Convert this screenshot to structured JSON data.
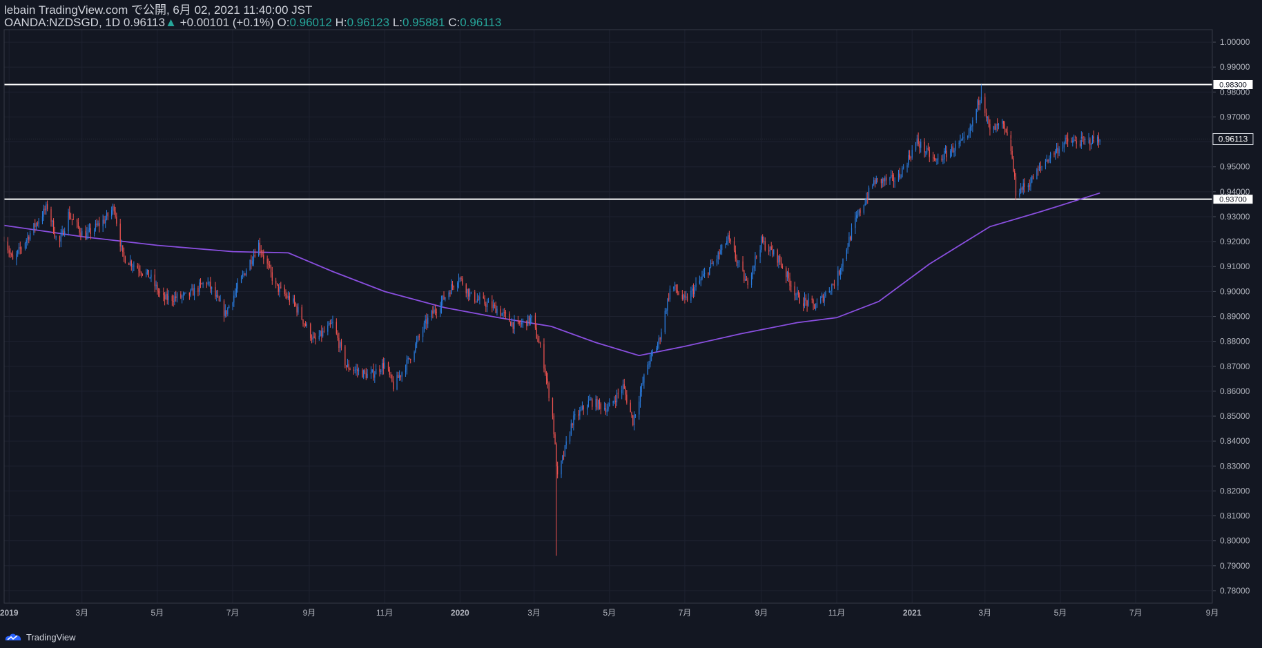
{
  "header": {
    "publish_line": "lebain TradingView.com で公開, 6月 02, 2021 11:40:00 JST",
    "symbol": "OANDA:NZDSGD, 1D",
    "last": "0.96113",
    "change_arrow": "▲",
    "change": "+0.00101 (+0.1%)",
    "o_label": "O:",
    "o_val": "0.96012",
    "h_label": "H:",
    "h_val": "0.96123",
    "l_label": "L:",
    "l_val": "0.95881",
    "c_label": "C:",
    "c_val": "0.96113"
  },
  "footer": {
    "brand": "TradingView",
    "logo_icon": "tradingview-logo-icon"
  },
  "colors": {
    "background": "#131722",
    "up": "#2a7de1",
    "down": "#ef5350",
    "ma": "#8a4fe0",
    "hline": "#ffffff",
    "grid": "#1e2230",
    "axis_text": "#b2b5be",
    "header_value": "#26a69a"
  },
  "chart_data": {
    "type": "candlestick",
    "symbol": "OANDA:NZDSGD",
    "interval": "1D",
    "ylim": [
      0.775,
      1.005
    ],
    "y_ticks": [
      1.0,
      0.99,
      0.98,
      0.97,
      0.96,
      0.95,
      0.94,
      0.93,
      0.92,
      0.91,
      0.9,
      0.89,
      0.88,
      0.87,
      0.86,
      0.85,
      0.84,
      0.83,
      0.82,
      0.81,
      0.8,
      0.79,
      0.78
    ],
    "y_tick_labels": [
      "1.00000",
      "0.99000",
      "0.98000",
      "0.97000",
      "0.96000",
      "0.95000",
      "0.94000",
      "0.93000",
      "0.92000",
      "0.91000",
      "0.90000",
      "0.89000",
      "0.88000",
      "0.87000",
      "0.86000",
      "0.85000",
      "0.84000",
      "0.83000",
      "0.82000",
      "0.81000",
      "0.80000",
      "0.79000",
      "0.78000"
    ],
    "x_ticks": [
      {
        "date": "2019-01-01",
        "label": "2019"
      },
      {
        "date": "2019-03-01",
        "label": "3月"
      },
      {
        "date": "2019-05-01",
        "label": "5月"
      },
      {
        "date": "2019-07-01",
        "label": "7月"
      },
      {
        "date": "2019-09-01",
        "label": "9月"
      },
      {
        "date": "2019-11-01",
        "label": "11月"
      },
      {
        "date": "2020-01-01",
        "label": "2020"
      },
      {
        "date": "2020-03-01",
        "label": "3月"
      },
      {
        "date": "2020-05-01",
        "label": "5月"
      },
      {
        "date": "2020-07-01",
        "label": "7月"
      },
      {
        "date": "2020-09-01",
        "label": "9月"
      },
      {
        "date": "2020-11-01",
        "label": "11月"
      },
      {
        "date": "2021-01-01",
        "label": "2021"
      },
      {
        "date": "2021-03-01",
        "label": "3月"
      },
      {
        "date": "2021-05-01",
        "label": "5月"
      },
      {
        "date": "2021-07-01",
        "label": "7月"
      },
      {
        "date": "2021-09-01",
        "label": "9月"
      }
    ],
    "x_start": "2018-12-28",
    "x_end": "2021-09-01",
    "horizontal_lines": [
      {
        "value": 0.983,
        "label": "0.98300"
      },
      {
        "value": 0.937,
        "label": "0.93700"
      }
    ],
    "last_price": {
      "value": 0.96113,
      "label": "0.96113"
    },
    "price_path": [
      {
        "date": "2018-12-28",
        "value": 0.922
      },
      {
        "date": "2019-01-04",
        "value": 0.912
      },
      {
        "date": "2019-01-20",
        "value": 0.925
      },
      {
        "date": "2019-02-01",
        "value": 0.934
      },
      {
        "date": "2019-02-10",
        "value": 0.918
      },
      {
        "date": "2019-02-18",
        "value": 0.931
      },
      {
        "date": "2019-03-03",
        "value": 0.922
      },
      {
        "date": "2019-03-20",
        "value": 0.929
      },
      {
        "date": "2019-03-27",
        "value": 0.934
      },
      {
        "date": "2019-04-03",
        "value": 0.914
      },
      {
        "date": "2019-04-25",
        "value": 0.906
      },
      {
        "date": "2019-05-05",
        "value": 0.897
      },
      {
        "date": "2019-05-25",
        "value": 0.898
      },
      {
        "date": "2019-06-10",
        "value": 0.904
      },
      {
        "date": "2019-06-25",
        "value": 0.891
      },
      {
        "date": "2019-07-10",
        "value": 0.907
      },
      {
        "date": "2019-07-22",
        "value": 0.919
      },
      {
        "date": "2019-08-05",
        "value": 0.902
      },
      {
        "date": "2019-08-20",
        "value": 0.895
      },
      {
        "date": "2019-09-05",
        "value": 0.88
      },
      {
        "date": "2019-09-20",
        "value": 0.887
      },
      {
        "date": "2019-10-01",
        "value": 0.87
      },
      {
        "date": "2019-10-20",
        "value": 0.866
      },
      {
        "date": "2019-11-01",
        "value": 0.871
      },
      {
        "date": "2019-11-08",
        "value": 0.862
      },
      {
        "date": "2019-11-20",
        "value": 0.872
      },
      {
        "date": "2019-12-05",
        "value": 0.888
      },
      {
        "date": "2019-12-20",
        "value": 0.898
      },
      {
        "date": "2019-12-31",
        "value": 0.906
      },
      {
        "date": "2020-01-10",
        "value": 0.898
      },
      {
        "date": "2020-01-31",
        "value": 0.893
      },
      {
        "date": "2020-02-15",
        "value": 0.886
      },
      {
        "date": "2020-02-28",
        "value": 0.889
      },
      {
        "date": "2020-03-08",
        "value": 0.874
      },
      {
        "date": "2020-03-16",
        "value": 0.85
      },
      {
        "date": "2020-03-20",
        "value": 0.825
      },
      {
        "date": "2020-04-01",
        "value": 0.848
      },
      {
        "date": "2020-04-15",
        "value": 0.856
      },
      {
        "date": "2020-04-30",
        "value": 0.853
      },
      {
        "date": "2020-05-12",
        "value": 0.862
      },
      {
        "date": "2020-05-20",
        "value": 0.848
      },
      {
        "date": "2020-06-01",
        "value": 0.871
      },
      {
        "date": "2020-06-10",
        "value": 0.88
      },
      {
        "date": "2020-06-20",
        "value": 0.903
      },
      {
        "date": "2020-07-01",
        "value": 0.896
      },
      {
        "date": "2020-07-25",
        "value": 0.912
      },
      {
        "date": "2020-08-05",
        "value": 0.921
      },
      {
        "date": "2020-08-20",
        "value": 0.903
      },
      {
        "date": "2020-09-01",
        "value": 0.92
      },
      {
        "date": "2020-09-15",
        "value": 0.913
      },
      {
        "date": "2020-10-01",
        "value": 0.897
      },
      {
        "date": "2020-10-15",
        "value": 0.894
      },
      {
        "date": "2020-11-01",
        "value": 0.905
      },
      {
        "date": "2020-11-15",
        "value": 0.927
      },
      {
        "date": "2020-12-01",
        "value": 0.944
      },
      {
        "date": "2020-12-20",
        "value": 0.945
      },
      {
        "date": "2021-01-05",
        "value": 0.96
      },
      {
        "date": "2021-01-20",
        "value": 0.952
      },
      {
        "date": "2021-02-05",
        "value": 0.958
      },
      {
        "date": "2021-02-15",
        "value": 0.961
      },
      {
        "date": "2021-02-26",
        "value": 0.98
      },
      {
        "date": "2021-03-05",
        "value": 0.964
      },
      {
        "date": "2021-03-15",
        "value": 0.967
      },
      {
        "date": "2021-03-22",
        "value": 0.957
      },
      {
        "date": "2021-03-26",
        "value": 0.94
      },
      {
        "date": "2021-04-05",
        "value": 0.943
      },
      {
        "date": "2021-04-20",
        "value": 0.953
      },
      {
        "date": "2021-05-05",
        "value": 0.96
      },
      {
        "date": "2021-05-20",
        "value": 0.96
      },
      {
        "date": "2021-06-02",
        "value": 0.96113
      }
    ],
    "wick_extremes": [
      {
        "date": "2020-03-19",
        "value": 0.794
      },
      {
        "date": "2021-02-26",
        "value": 0.983
      }
    ],
    "ma_path": [
      {
        "date": "2018-12-28",
        "value": 0.9265
      },
      {
        "date": "2019-03-01",
        "value": 0.922
      },
      {
        "date": "2019-05-01",
        "value": 0.9185
      },
      {
        "date": "2019-07-01",
        "value": 0.916
      },
      {
        "date": "2019-08-15",
        "value": 0.9155
      },
      {
        "date": "2019-09-20",
        "value": 0.908
      },
      {
        "date": "2019-11-01",
        "value": 0.9
      },
      {
        "date": "2019-12-20",
        "value": 0.8935
      },
      {
        "date": "2020-02-01",
        "value": 0.8895
      },
      {
        "date": "2020-03-15",
        "value": 0.886
      },
      {
        "date": "2020-04-20",
        "value": 0.8795
      },
      {
        "date": "2020-05-25",
        "value": 0.8743
      },
      {
        "date": "2020-07-01",
        "value": 0.878
      },
      {
        "date": "2020-08-15",
        "value": 0.883
      },
      {
        "date": "2020-09-30",
        "value": 0.8875
      },
      {
        "date": "2020-11-01",
        "value": 0.8895
      },
      {
        "date": "2020-12-05",
        "value": 0.896
      },
      {
        "date": "2021-01-15",
        "value": 0.911
      },
      {
        "date": "2021-03-05",
        "value": 0.926
      },
      {
        "date": "2021-04-15",
        "value": 0.932
      },
      {
        "date": "2021-06-02",
        "value": 0.9395
      }
    ]
  }
}
